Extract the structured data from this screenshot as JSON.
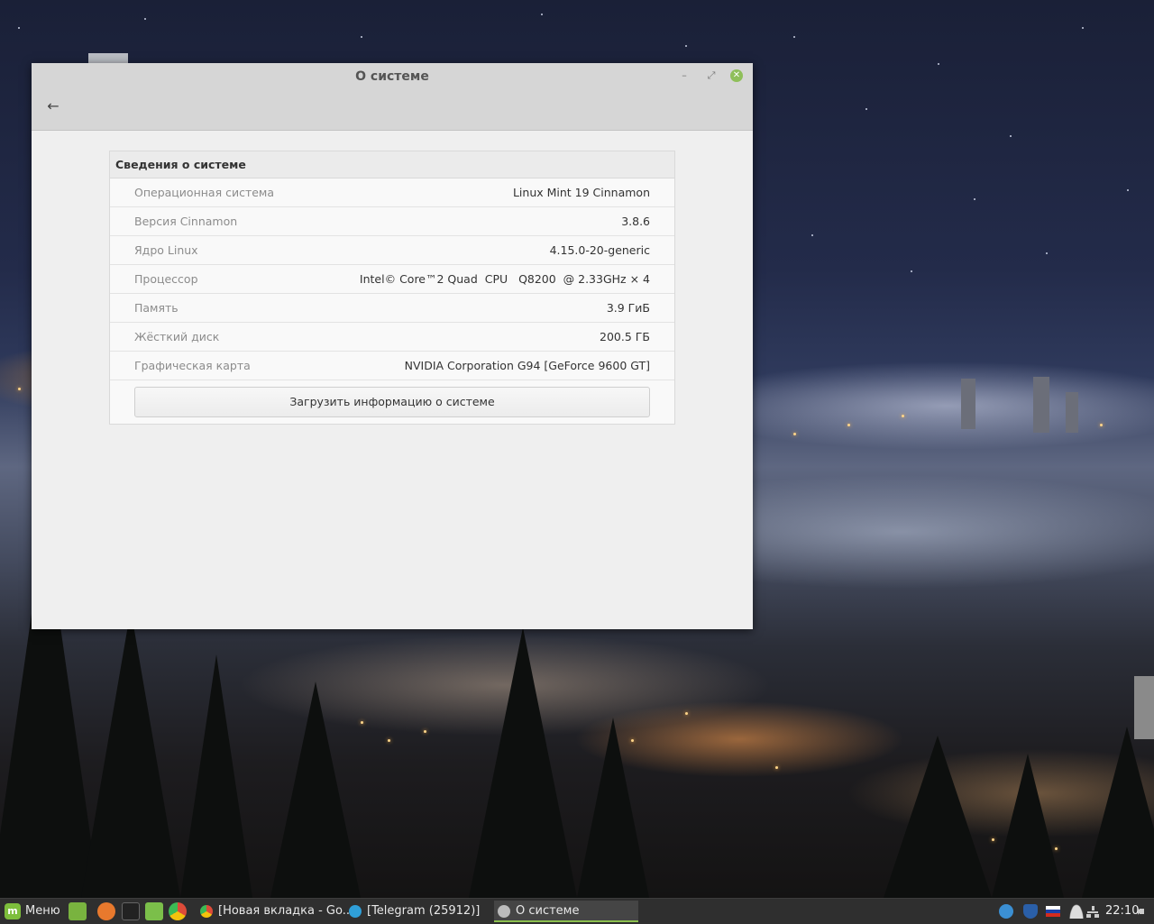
{
  "window": {
    "title": "О системе",
    "controls": {
      "minimize": "–",
      "maximize": "⤢",
      "close": "✕"
    },
    "back_icon": "←"
  },
  "system_info": {
    "header": "Сведения о системе",
    "rows": [
      {
        "label": "Операционная система",
        "value": "Linux Mint 19 Cinnamon"
      },
      {
        "label": "Версия Cinnamon",
        "value": "3.8.6"
      },
      {
        "label": "Ядро Linux",
        "value": "4.15.0-20-generic"
      },
      {
        "label": "Процессор",
        "value": "Intel© Core™2 Quad  CPU   Q8200  @ 2.33GHz × 4"
      },
      {
        "label": "Память",
        "value": "3.9 ГиБ"
      },
      {
        "label": "Жёсткий диск",
        "value": "200.5 ГБ"
      },
      {
        "label": "Графическая карта",
        "value": "NVIDIA Corporation G94 [GeForce 9600 GT]"
      }
    ],
    "upload_button": "Загрузить информацию о системе"
  },
  "taskbar": {
    "menu_label": "Меню",
    "launchers": [
      {
        "icon": "files-icon",
        "color": "#79b33f"
      },
      {
        "icon": "firefox-icon",
        "color": "#e8792d"
      },
      {
        "icon": "terminal-icon",
        "color": "#333333"
      },
      {
        "icon": "folder-icon",
        "color": "#7bbf4a"
      },
      {
        "icon": "chrome-icon",
        "color": "#dd4b39"
      }
    ],
    "tasks": [
      {
        "label": "[Новая вкладка - Go...",
        "icon": "chrome-icon",
        "color": "#dd4b39"
      },
      {
        "label": "[Telegram (25912)]",
        "icon": "telegram-icon",
        "color": "#2f9fd8"
      },
      {
        "label": "О системе",
        "icon": "gear-icon",
        "color": "#bbbbbb"
      }
    ],
    "tray": [
      "update-icon",
      "shield-icon",
      "keyboard-layout-ru-icon",
      "user-icon",
      "network-icon",
      "volume-icon"
    ],
    "clock": "22:10"
  }
}
